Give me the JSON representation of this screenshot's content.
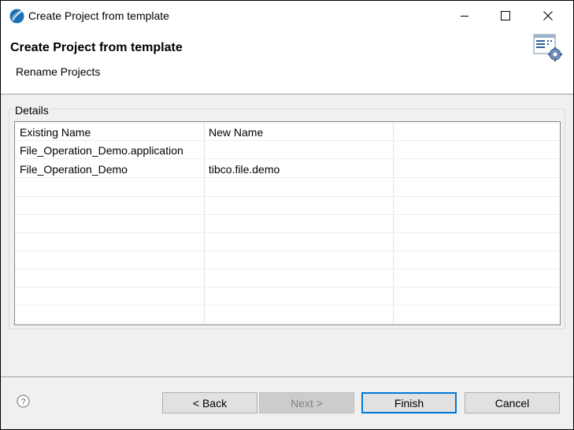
{
  "window": {
    "title": "Create Project from template",
    "controls": {
      "minimize": "minimize",
      "maximize": "maximize",
      "close": "close"
    }
  },
  "header": {
    "title": "Create Project from template",
    "subtitle": "Rename Projects",
    "icon": "wizard-settings-icon"
  },
  "details": {
    "label": "Details",
    "columns": [
      "Existing Name",
      "New Name",
      ""
    ],
    "rows": [
      {
        "existing": "File_Operation_Demo.application",
        "new": ""
      },
      {
        "existing": "File_Operation_Demo",
        "new": "tibco.file.demo"
      }
    ]
  },
  "footer": {
    "help_icon": "help-icon",
    "back_label": "< Back",
    "next_label": "Next >",
    "finish_label": "Finish",
    "cancel_label": "Cancel"
  },
  "colors": {
    "accent": "#0078d7",
    "app_icon": "#1a6fb5"
  }
}
